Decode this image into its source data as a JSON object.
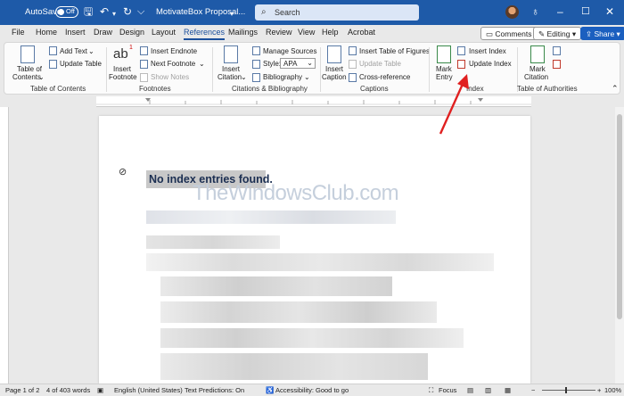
{
  "titlebar": {
    "autosave_label": "AutoSave",
    "autosave_state": "Off",
    "doc_title": "MotivateBox Proposal...",
    "search_placeholder": "Search"
  },
  "menu": {
    "tabs": [
      "File",
      "Home",
      "Insert",
      "Draw",
      "Design",
      "Layout",
      "References",
      "Mailings",
      "Review",
      "View",
      "Help",
      "Acrobat"
    ],
    "active_tab": "References",
    "comments": "Comments",
    "editing": "Editing",
    "share": "Share"
  },
  "ribbon": {
    "toc": {
      "btn1": "Table of",
      "btn2": "Contents",
      "add_text": "Add Text",
      "update_table": "Update Table",
      "group": "Table of Contents"
    },
    "footnotes": {
      "big1": "ab",
      "big2": "Insert",
      "big3": "Footnote",
      "insert_endnote": "Insert Endnote",
      "next_footnote": "Next Footnote",
      "show_notes": "Show Notes",
      "group": "Footnotes"
    },
    "citations": {
      "big1": "Insert",
      "big2": "Citation",
      "manage_sources": "Manage Sources",
      "style_label": "Style:",
      "style_value": "APA",
      "bibliography": "Bibliography",
      "group": "Citations & Bibliography"
    },
    "captions": {
      "big1": "Insert",
      "big2": "Caption",
      "insert_tof": "Insert Table of Figures",
      "update_table": "Update Table",
      "cross_ref": "Cross-reference",
      "group": "Captions"
    },
    "index": {
      "big1": "Mark",
      "big2": "Entry",
      "insert_index": "Insert Index",
      "update_index": "Update Index",
      "group": "Index"
    },
    "toa": {
      "big1": "Mark",
      "big2": "Citation",
      "group": "Table of Authorities"
    }
  },
  "document": {
    "heading": "No index entries found.",
    "watermark": "TheWindowsClub.com"
  },
  "status": {
    "page": "Page 1 of 2",
    "words": "4 of 403 words",
    "language": "English (United States)",
    "predictions": "Text Predictions: On",
    "accessibility": "Accessibility: Good to go",
    "focus": "Focus",
    "zoom": "100%"
  },
  "colors": {
    "titlebar": "#1e5aa8",
    "accent": "#1b4f9c",
    "arrow": "#e02020"
  }
}
